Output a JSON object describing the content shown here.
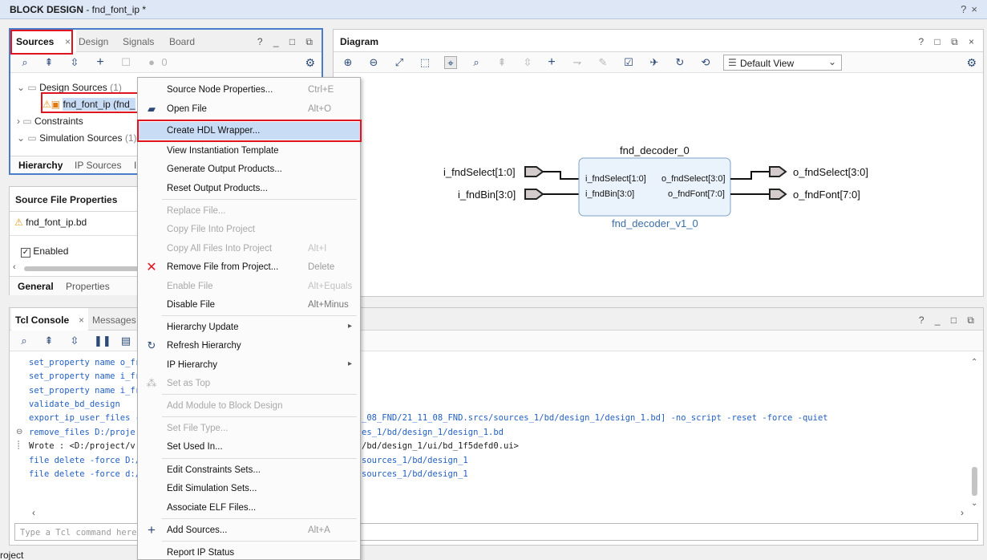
{
  "titlebar": {
    "title": "BLOCK DESIGN",
    "subtitle": " - fnd_font_ip *",
    "help": "?",
    "close": "×"
  },
  "sources": {
    "tabs": [
      "Sources",
      "Design",
      "Signals",
      "Board"
    ],
    "close_glyph": "×",
    "tab_icons": "? _ □ ⧉",
    "toolbar_count": "0",
    "tree": {
      "design_sources": "Design Sources",
      "design_sources_count": "(1)",
      "fnd_font_ip": "fnd_font_ip (fnd_",
      "constraints": "Constraints",
      "simulation_sources": "Simulation Sources",
      "simulation_sources_count": "(1)"
    },
    "subtabs": [
      "Hierarchy",
      "IP Sources",
      "I"
    ]
  },
  "props": {
    "title": "Source File Properties",
    "file": "fnd_font_ip.bd",
    "enabled_label": "Enabled",
    "subtabs": [
      "General",
      "Properties"
    ]
  },
  "diagram": {
    "title": "Diagram",
    "tab_icons": "? □ ⧉ ×",
    "view_select": "Default View",
    "block": {
      "instance": "fnd_decoder_0",
      "module": "fnd_decoder_v1_0",
      "in_pins": [
        "i_fndSelect[1:0]",
        "i_fndBin[3:0]"
      ],
      "out_pins": [
        "o_fndSelect[3:0]",
        "o_fndFont[7:0]"
      ]
    },
    "ports_in": [
      "i_fndSelect[1:0]",
      "i_fndBin[3:0]"
    ],
    "ports_out": [
      "o_fndSelect[3:0]",
      "o_fndFont[7:0]"
    ]
  },
  "console": {
    "tabs": [
      "Tcl Console",
      "Messages"
    ],
    "close_glyph": "×",
    "tab_icons": "? _ □ ⧉",
    "left_lines": [
      "set_property name o_fr",
      "set_property name i_fr",
      "set_property name i_fr",
      "validate_bd_design",
      "export_ip_user_files -",
      "remove_files  D:/proje",
      "Wrote  : <D:/project/v",
      "file delete -force D:/",
      "file delete -force d:/"
    ],
    "right_lines": [
      "_08_FND/21_11_08_FND.srcs/sources_1/bd/design_1/design_1.bd] -no_script -reset -force -quiet",
      "es_1/bd/design_1/design_1.bd",
      "/bd/design_1/ui/bd_1f5defd0.ui>",
      "sources_1/bd/design_1",
      "sources_1/bd/design_1"
    ],
    "input_placeholder": "Type a Tcl command here"
  },
  "status_bar": {
    "text": "roject"
  },
  "menu": {
    "items": [
      {
        "label": "Source Node Properties...",
        "shortcut": "Ctrl+E"
      },
      {
        "label": "Open File",
        "shortcut": "Alt+O"
      },
      {
        "label": "Create HDL Wrapper..."
      },
      {
        "label": "View Instantiation Template"
      },
      {
        "label": "Generate Output Products..."
      },
      {
        "label": "Reset Output Products..."
      },
      {
        "label": "Replace File..."
      },
      {
        "label": "Copy File Into Project"
      },
      {
        "label": "Copy All Files Into Project",
        "shortcut": "Alt+I"
      },
      {
        "label": "Remove File from Project...",
        "shortcut": "Delete"
      },
      {
        "label": "Enable File",
        "shortcut": "Alt+Equals"
      },
      {
        "label": "Disable File",
        "shortcut": "Alt+Minus"
      },
      {
        "label": "Hierarchy Update"
      },
      {
        "label": "Refresh Hierarchy"
      },
      {
        "label": "IP Hierarchy"
      },
      {
        "label": "Set as Top"
      },
      {
        "label": "Add Module to Block Design"
      },
      {
        "label": "Set File Type..."
      },
      {
        "label": "Set Used In..."
      },
      {
        "label": "Edit Constraints Sets..."
      },
      {
        "label": "Edit Simulation Sets..."
      },
      {
        "label": "Associate ELF Files..."
      },
      {
        "label": "Add Sources...",
        "shortcut": "Alt+A"
      },
      {
        "label": "Report IP Status"
      }
    ]
  },
  "colors": {
    "accent": "#4a7cc9",
    "highlight": "#c9dcf6",
    "annotation": "#e0141e",
    "console_text": "#2360c4"
  }
}
